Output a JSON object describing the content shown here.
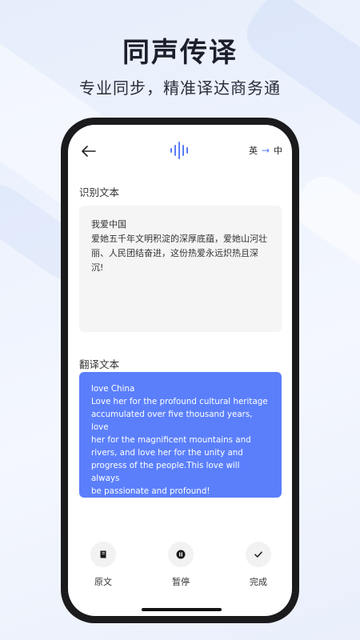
{
  "hero": {
    "title": "同声传译",
    "subtitle": "专业同步，精准译达商务通"
  },
  "topbar": {
    "back_icon": "back-arrow-icon",
    "center_icon": "sound-wave-icon",
    "source_lang": "英",
    "arrow": "→",
    "target_lang": "中"
  },
  "recognized": {
    "label": "识别文本",
    "text": "我爱中国\n爱她五千年文明积淀的深厚底蕴，爱她山河壮\n丽、人民团结奋进，这份热爱永远炽热且深\n沉!"
  },
  "translated": {
    "label": "翻译文本",
    "text": "love China\nLove her for the profound cultural heritage\naccumulated over five thousand years, love\nher for the magnificent mountains and\nrivers, and love her for the unity and\nprogress of the people.This love will always\nbe passionate and profound!"
  },
  "actions": [
    {
      "label": "原文",
      "icon": "book-icon"
    },
    {
      "label": "暂停",
      "icon": "pause-icon"
    },
    {
      "label": "完成",
      "icon": "check-icon"
    }
  ],
  "colors": {
    "accent": "#5b7ffb",
    "arrow": "#5b7cf6"
  }
}
